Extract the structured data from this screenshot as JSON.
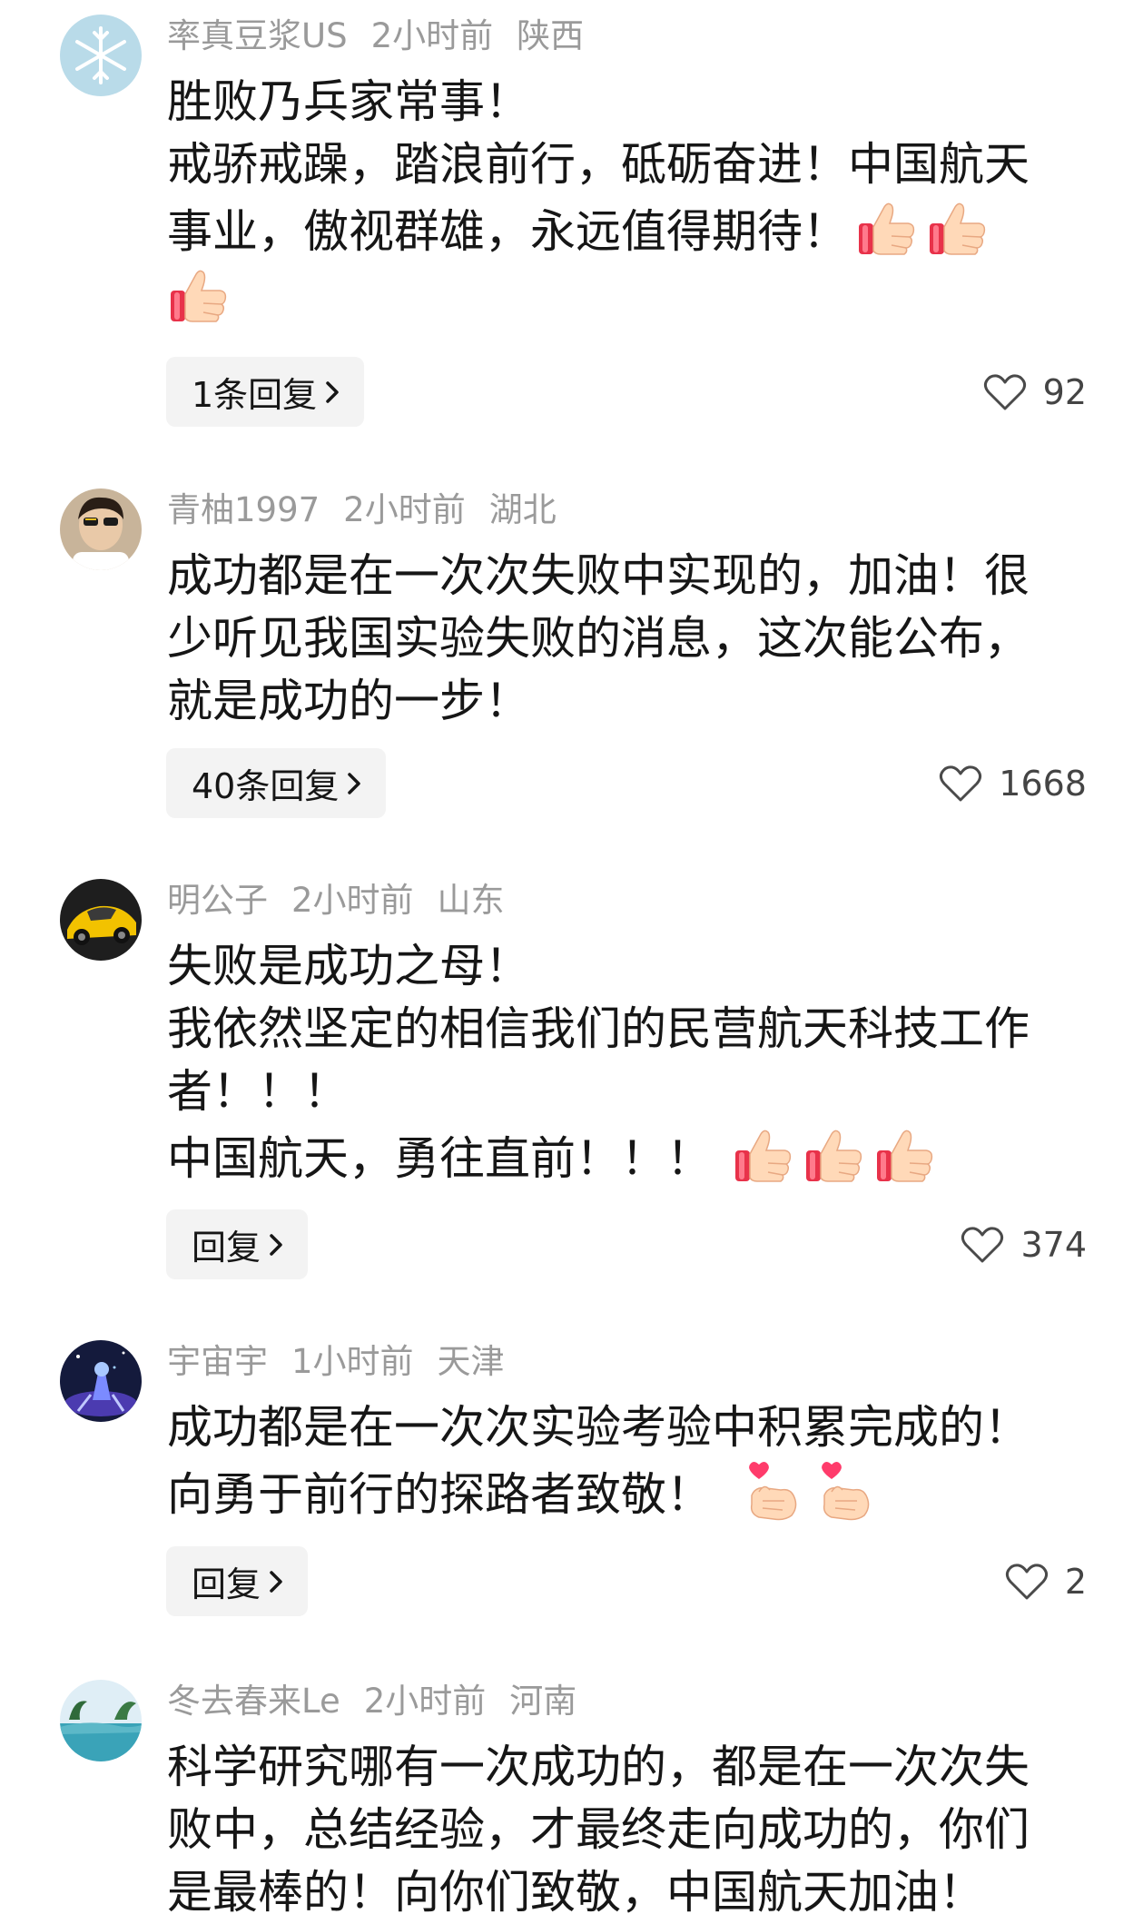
{
  "comments": [
    {
      "username": "率真豆浆US",
      "time": "2小时前",
      "location": "陕西",
      "lines": [
        "胜败乃兵家常事！",
        "戒骄戒躁，踏浪前行，砥砺奋进！中国航天",
        "事业，傲视群雄，永远值得期待！",
        ""
      ],
      "reply_label": "1条回复",
      "likes": "92",
      "avatar_icon": "snowflake-avatar"
    },
    {
      "username": "青柚1997",
      "time": "2小时前",
      "location": "湖北",
      "lines": [
        "成功都是在一次次失败中实现的，加油！很",
        "少听见我国实验失败的消息，这次能公布，",
        "就是成功的一步！"
      ],
      "reply_label": "40条回复",
      "likes": "1668",
      "avatar_icon": "person-avatar"
    },
    {
      "username": "明公子",
      "time": "2小时前",
      "location": "山东",
      "lines": [
        "失败是成功之母！",
        "我依然坚定的相信我们的民营航天科技工作",
        "者！！！",
        "中国航天，勇往直前！！！"
      ],
      "reply_label": "回复",
      "likes": "374",
      "avatar_icon": "yellow-car-avatar"
    },
    {
      "username": "宇宙宇",
      "time": "1小时前",
      "location": "天津",
      "lines": [
        "成功都是在一次次实验考验中积累完成的！",
        "向勇于前行的探路者致敬！"
      ],
      "reply_label": "回复",
      "likes": "2",
      "avatar_icon": "space-avatar"
    },
    {
      "username": "冬去春来Le",
      "time": "2小时前",
      "location": "河南",
      "lines": [
        "科学研究哪有一次成功的，都是在一次次失",
        "败中，总结经验，才最终走向成功的，你们",
        "是最棒的！向你们致敬，中国航天加油！"
      ],
      "reply_label": "",
      "likes": "",
      "avatar_icon": "seaside-avatar"
    }
  ],
  "icons": {
    "thumbs_up": "thumbs-up-emoji",
    "finger_heart": "finger-heart-emoji",
    "like": "heart-outline-icon",
    "chevron": "chevron-right-icon"
  },
  "colors": {
    "meta_text": "#9a9a9a",
    "body_text": "#161616",
    "reply_bg": "#f3f3f3"
  }
}
